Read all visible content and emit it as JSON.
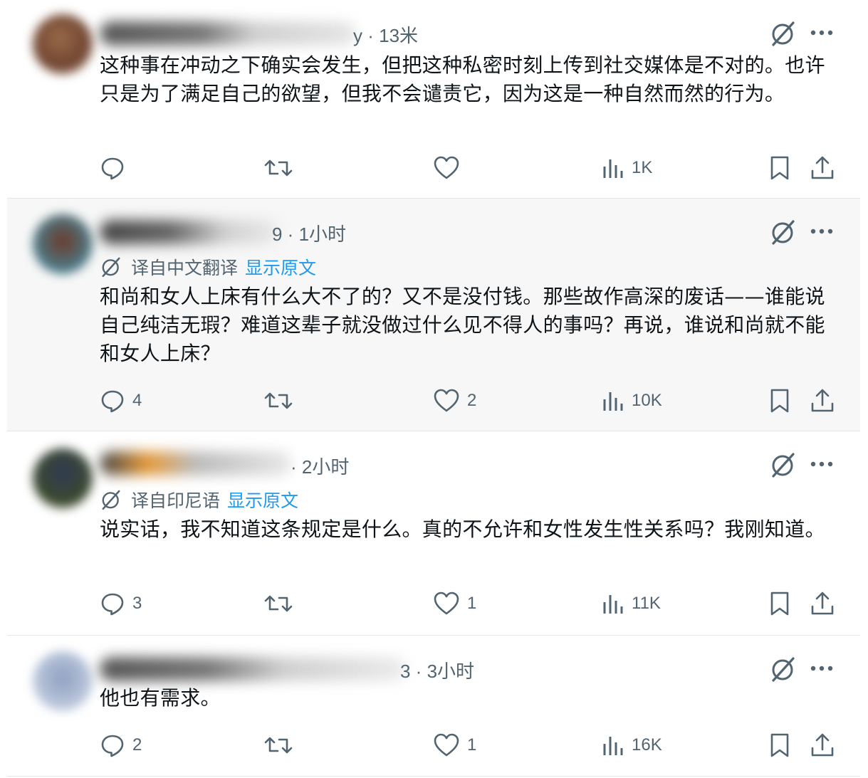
{
  "posts": [
    {
      "time_suffix": "y · 13米",
      "translated_from": "",
      "show_original": "",
      "text": "这种事在冲动之下确实会发生，但把这种私密时刻上传到社交媒体是不对的。也许只是为了满足自己的欲望，但我不会谴责它，因为这是一种自然而然的行为。",
      "replies": "",
      "likes": "",
      "views": "1K"
    },
    {
      "time_suffix": "9 · 1小时",
      "translated_from": "译自中文翻译",
      "show_original": "显示原文",
      "text": "和尚和女人上床有什么大不了的？又不是没付钱。那些故作高深的废话——谁能说自己纯洁无瑕？难道这辈子就没做过什么见不得人的事吗？再说，谁说和尚就不能和女人上床？",
      "replies": "4",
      "likes": "2",
      "views": "10K"
    },
    {
      "time_suffix": "· 2小时",
      "translated_from": "译自印尼语",
      "show_original": "显示原文",
      "text": "说实话，我不知道这条规定是什么。真的不允许和女性发生性关系吗？我刚知道。",
      "replies": "3",
      "likes": "1",
      "views": "11K"
    },
    {
      "time_suffix": "3 · 3小时",
      "translated_from": "",
      "show_original": "",
      "text": "他也有需求。",
      "replies": "2",
      "likes": "1",
      "views": "16K"
    }
  ],
  "icons": {
    "reply": "reply-icon",
    "repost": "repost-icon",
    "like": "heart-icon",
    "views": "views-chart-icon",
    "bookmark": "bookmark-icon",
    "share": "share-icon",
    "grok": "grok-slash-circle-icon",
    "more": "more-dots-icon",
    "translate": "translate-icon"
  },
  "colors": {
    "icon_gray": "#536471",
    "link_blue": "#1d9bf0",
    "text": "#0f1419",
    "highlight_bg": "#f7f7f7"
  }
}
